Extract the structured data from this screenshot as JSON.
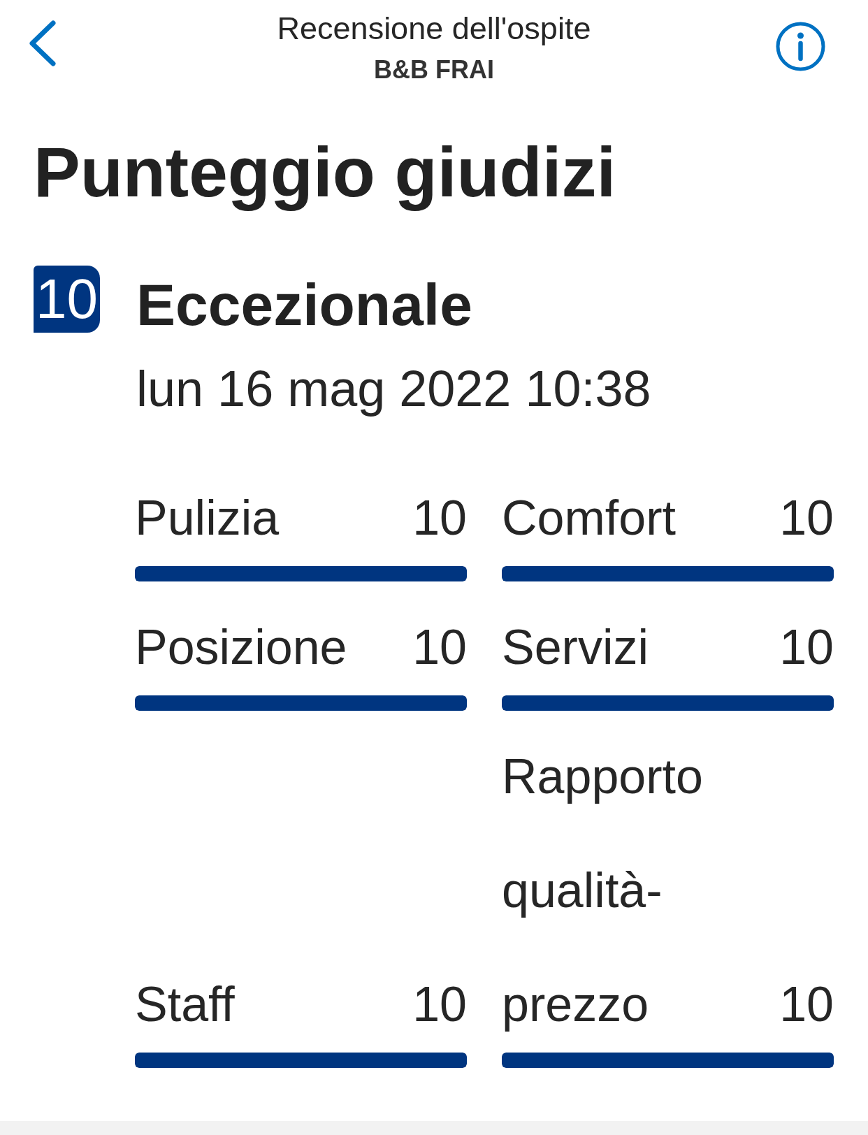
{
  "nav": {
    "title": "Recensione dell'ospite",
    "subtitle": "B&B FRAI"
  },
  "heading": "Punteggio giudizi",
  "score": {
    "value": "10",
    "label": "Eccezionale",
    "date": "lun 16 mag 2022 10:38"
  },
  "categories": [
    {
      "name": "Pulizia",
      "score": "10",
      "level": 1
    },
    {
      "name": "Posizione",
      "score": "10",
      "level": 1
    },
    {
      "name": "Staff",
      "score": "10",
      "level": 1
    },
    {
      "name": "Comfort",
      "score": "10",
      "level": 1
    },
    {
      "name": "Servizi",
      "score": "10",
      "level": 1
    },
    {
      "name": "Rapporto qualità-prezzo",
      "score": "10",
      "level": 1
    }
  ]
}
